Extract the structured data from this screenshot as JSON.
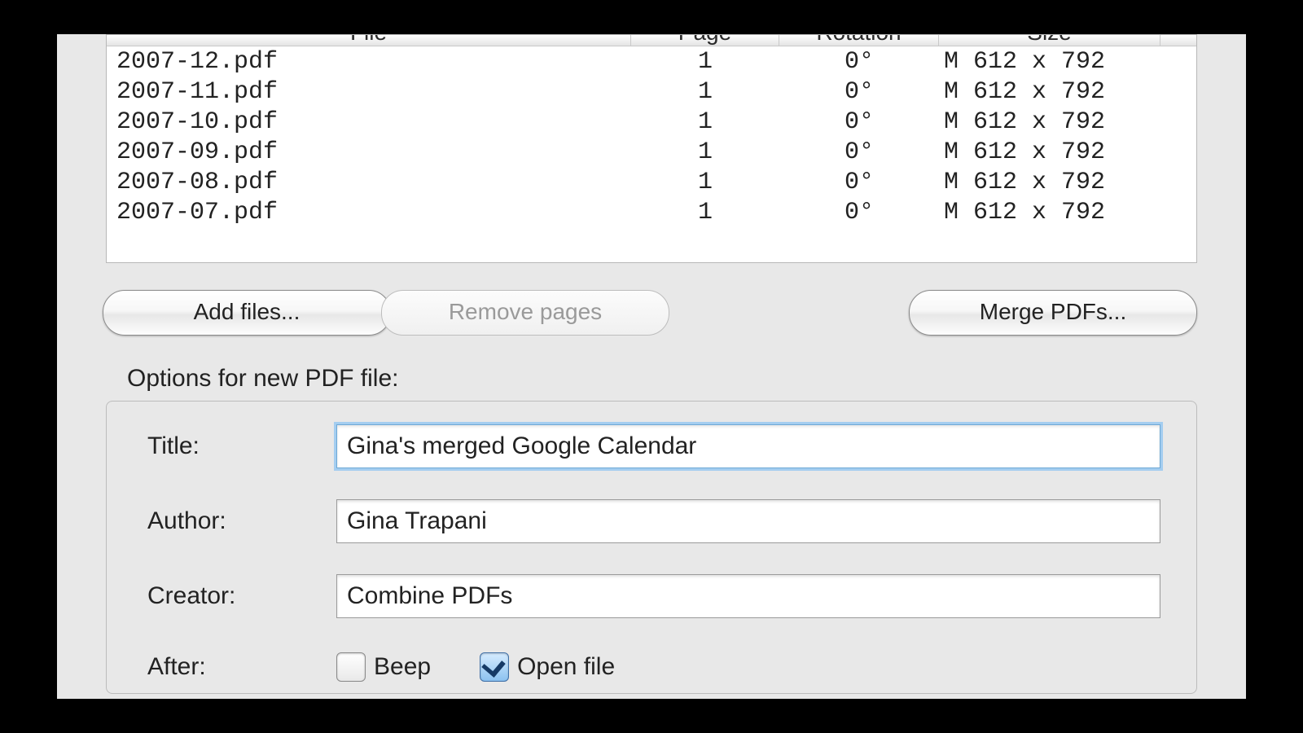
{
  "table": {
    "headers": {
      "file": "File",
      "page": "Page",
      "rotation": "Rotation",
      "size": "Size"
    },
    "rows": [
      {
        "file": "2007-12.pdf",
        "page": "1",
        "rotation": "0°",
        "size": "M 612 x 792"
      },
      {
        "file": "2007-11.pdf",
        "page": "1",
        "rotation": "0°",
        "size": "M 612 x 792"
      },
      {
        "file": "2007-10.pdf",
        "page": "1",
        "rotation": "0°",
        "size": "M 612 x 792"
      },
      {
        "file": "2007-09.pdf",
        "page": "1",
        "rotation": "0°",
        "size": "M 612 x 792"
      },
      {
        "file": "2007-08.pdf",
        "page": "1",
        "rotation": "0°",
        "size": "M 612 x 792"
      },
      {
        "file": "2007-07.pdf",
        "page": "1",
        "rotation": "0°",
        "size": "M 612 x 792"
      }
    ]
  },
  "actions": {
    "add_files": "Add files...",
    "remove_pages": "Remove pages",
    "merge_pdfs": "Merge PDFs..."
  },
  "options": {
    "heading": "Options for new PDF file:",
    "labels": {
      "title": "Title:",
      "author": "Author:",
      "creator": "Creator:",
      "after": "After:"
    },
    "values": {
      "title": "Gina's merged Google Calendar",
      "author": "Gina Trapani",
      "creator": "Combine PDFs"
    },
    "after": {
      "beep_label": "Beep",
      "beep_checked": false,
      "open_label": "Open file",
      "open_checked": true
    }
  }
}
